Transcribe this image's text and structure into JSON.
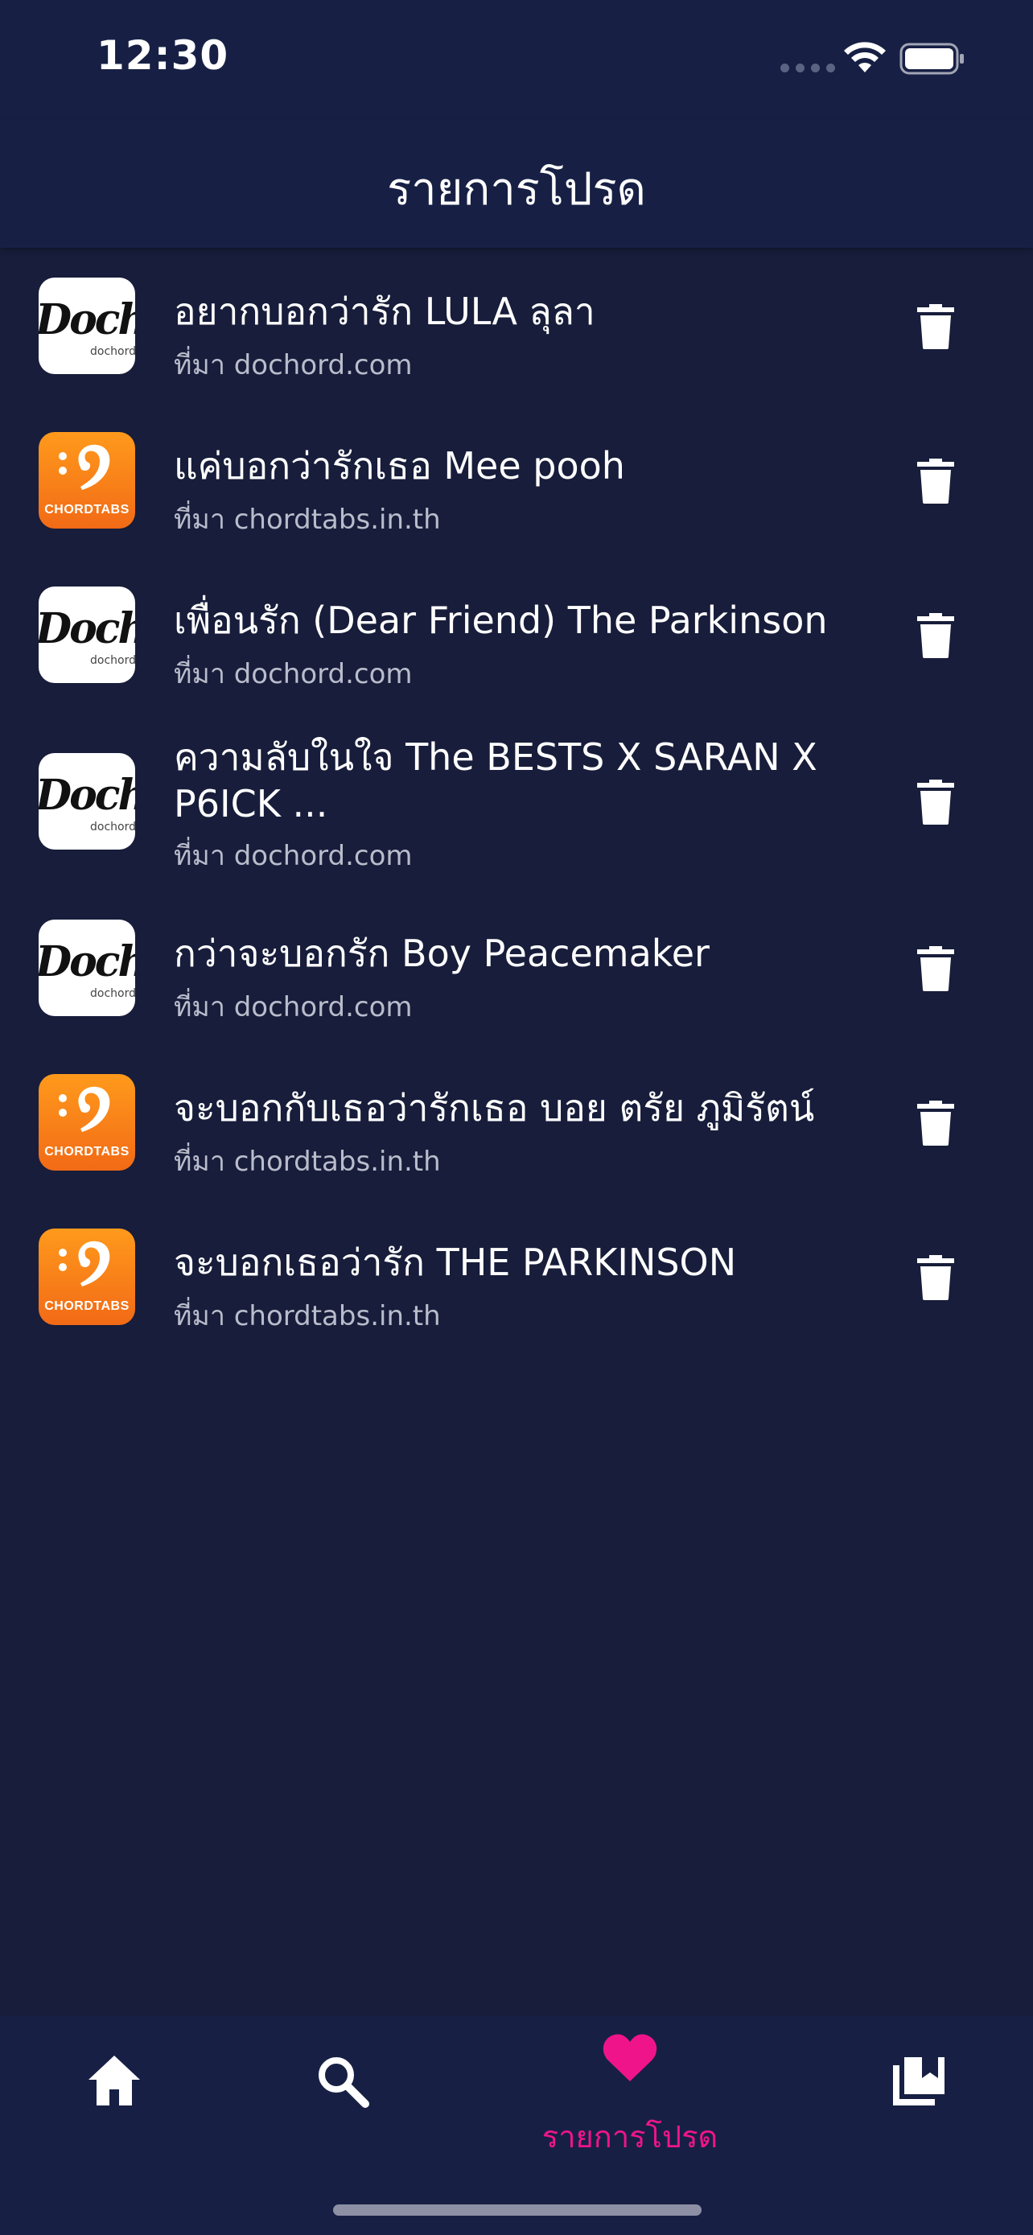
{
  "status_bar": {
    "time": "12:30"
  },
  "header": {
    "title": "รายการโปรด"
  },
  "favorites": [
    {
      "title": "อยากบอกว่ารัก LULA ลุลา",
      "source": "ที่มา dochord.com",
      "logo": "dochord"
    },
    {
      "title": "แค่บอกว่ารักเธอ Mee pooh",
      "source": "ที่มา chordtabs.in.th",
      "logo": "chordtabs"
    },
    {
      "title": "เพื่อนรัก (Dear Friend) The Parkinson",
      "source": "ที่มา dochord.com",
      "logo": "dochord"
    },
    {
      "title": "ความลับในใจ The BESTS X SARAN X P6ICK ...",
      "source": "ที่มา dochord.com",
      "logo": "dochord"
    },
    {
      "title": "กว่าจะบอกรัก Boy Peacemaker",
      "source": "ที่มา dochord.com",
      "logo": "dochord"
    },
    {
      "title": "จะบอกกับเธอว่ารักเธอ บอย ตรัย ภูมิรัตน์",
      "source": "ที่มา chordtabs.in.th",
      "logo": "chordtabs"
    },
    {
      "title": "จะบอกเธอว่ารัก THE PARKINSON",
      "source": "ที่มา chordtabs.in.th",
      "logo": "chordtabs"
    }
  ],
  "logos": {
    "dochord_text": "Dochord",
    "dochord_sub": "dochord",
    "chordtabs_text": "CHORDTABS"
  },
  "bottom_nav": {
    "items": [
      {
        "icon": "home-icon",
        "active": false
      },
      {
        "icon": "search-icon",
        "active": false
      },
      {
        "icon": "heart-icon",
        "label": "รายการโปรด",
        "active": true
      },
      {
        "icon": "library-icon",
        "active": false
      }
    ]
  },
  "colors": {
    "background": "#171d3a",
    "bars": "#172044",
    "accent": "#f0148b",
    "secondary_text": "#b9bccb"
  }
}
